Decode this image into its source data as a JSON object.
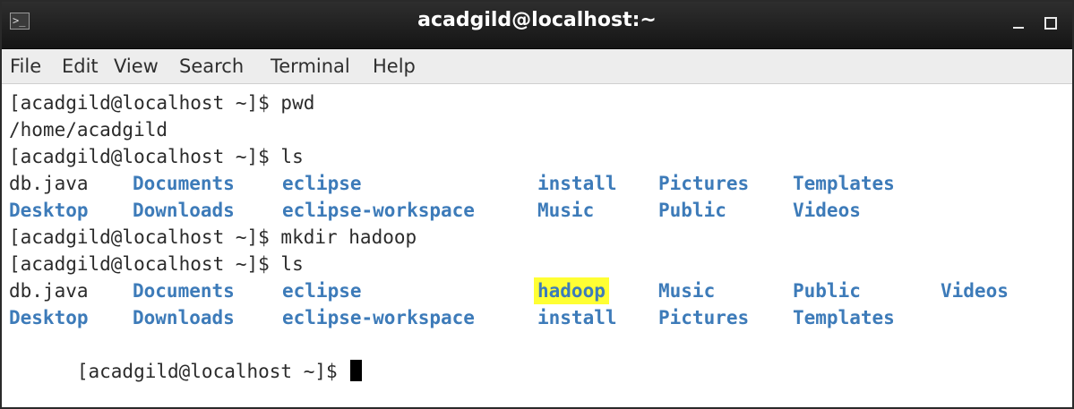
{
  "window": {
    "title": "acadgild@localhost:~",
    "icon": "terminal-icon",
    "minimize_icon": "minimize-icon",
    "maximize_icon": "maximize-icon"
  },
  "menu": {
    "items": [
      "File",
      "Edit",
      "View",
      "Search",
      "Terminal",
      "Help"
    ]
  },
  "terminal": {
    "prompt": "[acadgild@localhost ~]$ ",
    "lines": [
      {
        "type": "command",
        "text": "[acadgild@localhost ~]$ pwd"
      },
      {
        "type": "output",
        "text": "/home/acadgild"
      },
      {
        "type": "command",
        "text": "[acadgild@localhost ~]$ ls"
      },
      {
        "type": "listing",
        "entries": [
          {
            "name": "db.java",
            "kind": "file"
          },
          {
            "name": "Documents",
            "kind": "dir"
          },
          {
            "name": "eclipse",
            "kind": "dir"
          },
          {
            "name": "install",
            "kind": "dir"
          },
          {
            "name": "Pictures",
            "kind": "dir"
          },
          {
            "name": "Templates",
            "kind": "dir"
          }
        ]
      },
      {
        "type": "listing",
        "entries": [
          {
            "name": "Desktop",
            "kind": "dir"
          },
          {
            "name": "Downloads",
            "kind": "dir"
          },
          {
            "name": "eclipse-workspace",
            "kind": "dir"
          },
          {
            "name": "Music",
            "kind": "dir"
          },
          {
            "name": "Public",
            "kind": "dir"
          },
          {
            "name": "Videos",
            "kind": "dir"
          }
        ]
      },
      {
        "type": "command",
        "text": "[acadgild@localhost ~]$ mkdir hadoop"
      },
      {
        "type": "command",
        "text": "[acadgild@localhost ~]$ ls"
      },
      {
        "type": "listing",
        "entries": [
          {
            "name": "db.java",
            "kind": "file"
          },
          {
            "name": "Documents",
            "kind": "dir"
          },
          {
            "name": "eclipse",
            "kind": "dir"
          },
          {
            "name": "hadoop",
            "kind": "dir",
            "highlighted": true
          },
          {
            "name": "Music",
            "kind": "dir"
          },
          {
            "name": "Public",
            "kind": "dir"
          },
          {
            "name": "Videos",
            "kind": "dir"
          }
        ]
      },
      {
        "type": "listing",
        "entries": [
          {
            "name": "Desktop",
            "kind": "dir"
          },
          {
            "name": "Downloads",
            "kind": "dir"
          },
          {
            "name": "eclipse-workspace",
            "kind": "dir"
          },
          {
            "name": "install",
            "kind": "dir"
          },
          {
            "name": "Pictures",
            "kind": "dir"
          },
          {
            "name": "Templates",
            "kind": "dir"
          }
        ]
      },
      {
        "type": "prompt",
        "text": "[acadgild@localhost ~]$ "
      }
    ]
  },
  "colors": {
    "directory": "#3d7bb9",
    "text": "#2b2b2b",
    "highlight": "#ffff33",
    "titlebar": "#1e1e1e"
  }
}
